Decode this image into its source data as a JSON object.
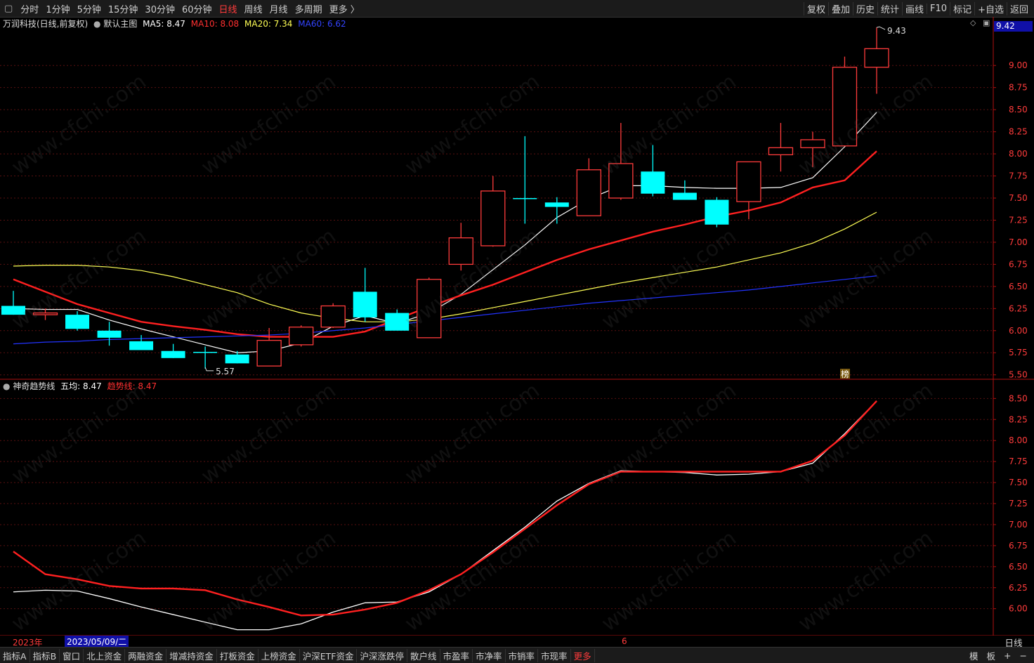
{
  "top_toolbar": {
    "periods": [
      "分时",
      "1分钟",
      "5分钟",
      "15分钟",
      "30分钟",
      "60分钟",
      "日线",
      "周线",
      "月线",
      "多周期",
      "更多 〉"
    ],
    "active_period": "日线",
    "tools": [
      "复权",
      "叠加",
      "历史",
      "统计",
      "画线",
      "F10",
      "标记",
      "+自选",
      "返回"
    ]
  },
  "main_legend": {
    "title": "万润科技(日线,前复权)",
    "template": "默认主图",
    "ma5_label": "MA5: 8.47",
    "ma10_label": "MA10: 8.08",
    "ma20_label": "MA20: 7.34",
    "ma60_label": "MA60: 6.62",
    "price_tag": "9.42"
  },
  "sub_legend": {
    "title": "神奇趋势线",
    "five_avg_label": "五均: 8.47",
    "trend_label": "趋势线: 8.47"
  },
  "colors": {
    "up": "#ff3b3b",
    "down": "#00ffff",
    "ma5": "#ffffff",
    "ma10": "#ff2020",
    "ma20": "#ffff55",
    "ma60": "#2233ff",
    "grid": "#5a1010"
  },
  "chart_data": [
    {
      "type": "candlestick",
      "title": "万润科技(日线,前复权)",
      "ylim": [
        5.45,
        9.55
      ],
      "y_ticks": [
        5.5,
        5.75,
        6.0,
        6.25,
        6.5,
        6.75,
        7.0,
        7.25,
        7.5,
        7.75,
        8.0,
        8.25,
        8.5,
        8.75,
        9.0
      ],
      "high_annotation": "9.43",
      "low_annotation": "5.57",
      "marker": "榜",
      "ohlc": [
        [
          6.28,
          6.45,
          6.18,
          6.18
        ],
        [
          6.18,
          6.25,
          6.12,
          6.2
        ],
        [
          6.18,
          6.22,
          6.0,
          6.02
        ],
        [
          6.0,
          6.1,
          5.83,
          5.92
        ],
        [
          5.88,
          5.95,
          5.79,
          5.78
        ],
        [
          5.77,
          5.85,
          5.69,
          5.69
        ],
        [
          5.76,
          5.82,
          5.57,
          5.76
        ],
        [
          5.73,
          5.77,
          5.63,
          5.63
        ],
        [
          5.6,
          6.03,
          5.6,
          5.89
        ],
        [
          5.84,
          6.06,
          5.82,
          6.04
        ],
        [
          6.04,
          6.31,
          6.03,
          6.28
        ],
        [
          6.44,
          6.71,
          6.1,
          6.15
        ],
        [
          6.2,
          6.24,
          6.01,
          6.0
        ],
        [
          5.92,
          6.6,
          5.92,
          6.58
        ],
        [
          6.75,
          7.22,
          6.68,
          7.05
        ],
        [
          6.96,
          7.75,
          6.95,
          7.58
        ],
        [
          7.5,
          8.2,
          7.21,
          7.5
        ],
        [
          7.45,
          7.51,
          7.21,
          7.4
        ],
        [
          7.3,
          7.95,
          7.3,
          7.82
        ],
        [
          7.5,
          8.35,
          7.48,
          7.89
        ],
        [
          7.8,
          8.1,
          7.52,
          7.55
        ],
        [
          7.56,
          7.7,
          7.48,
          7.48
        ],
        [
          7.48,
          7.51,
          7.17,
          7.2
        ],
        [
          7.46,
          7.91,
          7.26,
          7.91
        ],
        [
          7.99,
          8.35,
          7.8,
          8.07
        ],
        [
          8.07,
          8.25,
          7.85,
          8.16
        ],
        [
          8.09,
          9.1,
          8.09,
          8.98
        ],
        [
          8.98,
          9.43,
          8.68,
          9.19
        ]
      ],
      "series": [
        {
          "name": "MA5",
          "values": [
            6.25,
            6.24,
            6.24,
            6.12,
            6.02,
            5.93,
            5.84,
            5.75,
            5.77,
            5.86,
            6.05,
            6.17,
            6.08,
            6.2,
            6.41,
            6.69,
            6.97,
            7.28,
            7.49,
            7.64,
            7.64,
            7.62,
            7.61,
            7.61,
            7.62,
            7.73,
            8.08,
            8.47
          ]
        },
        {
          "name": "MA10",
          "values": [
            6.58,
            6.44,
            6.3,
            6.2,
            6.1,
            6.05,
            6.01,
            5.96,
            5.93,
            5.93,
            5.93,
            5.99,
            6.13,
            6.27,
            6.4,
            6.52,
            6.66,
            6.8,
            6.92,
            7.02,
            7.12,
            7.2,
            7.29,
            7.36,
            7.45,
            7.62,
            7.7,
            8.03
          ]
        },
        {
          "name": "MA20",
          "values": [
            6.73,
            6.74,
            6.74,
            6.72,
            6.68,
            6.61,
            6.52,
            6.43,
            6.3,
            6.2,
            6.14,
            6.1,
            6.1,
            6.13,
            6.19,
            6.26,
            6.33,
            6.4,
            6.47,
            6.54,
            6.6,
            6.66,
            6.72,
            6.8,
            6.88,
            6.99,
            7.15,
            7.34
          ]
        },
        {
          "name": "MA60",
          "values": [
            5.85,
            5.87,
            5.88,
            5.9,
            5.91,
            5.92,
            5.93,
            5.94,
            5.95,
            5.97,
            6.0,
            6.03,
            6.07,
            6.11,
            6.15,
            6.19,
            6.23,
            6.27,
            6.31,
            6.34,
            6.37,
            6.4,
            6.43,
            6.46,
            6.5,
            6.54,
            6.58,
            6.62
          ]
        }
      ]
    },
    {
      "type": "line",
      "title": "神奇趋势线",
      "ylim": [
        5.68,
        8.72
      ],
      "y_ticks": [
        6.0,
        6.25,
        6.5,
        6.75,
        7.0,
        7.25,
        7.5,
        7.75,
        8.0,
        8.25,
        8.5
      ],
      "series": [
        {
          "name": "五均",
          "values": [
            6.2,
            6.22,
            6.21,
            6.12,
            6.02,
            5.93,
            5.84,
            5.75,
            5.75,
            5.82,
            5.96,
            6.07,
            6.08,
            6.2,
            6.41,
            6.69,
            6.97,
            7.28,
            7.49,
            7.64,
            7.63,
            7.62,
            7.59,
            7.6,
            7.63,
            7.73,
            8.08,
            8.47
          ]
        },
        {
          "name": "趋势线",
          "values": [
            6.68,
            6.41,
            6.35,
            6.27,
            6.24,
            6.24,
            6.22,
            6.11,
            6.02,
            5.92,
            5.93,
            5.99,
            6.07,
            6.22,
            6.41,
            6.67,
            6.95,
            7.23,
            7.48,
            7.63,
            7.63,
            7.63,
            7.63,
            7.63,
            7.63,
            7.76,
            8.06,
            8.47
          ]
        }
      ]
    }
  ],
  "time_axis": {
    "year_label": "2023年",
    "cursor_date": "2023/05/09/二",
    "month_label": "6",
    "period_box": "日线"
  },
  "bottom_tabs": [
    "指标A",
    "指标B",
    "窗口",
    "北上资金",
    "两融资金",
    "增减持资金",
    "打板资金",
    "上榜资金",
    "沪深ETF资金",
    "沪深涨跌停",
    "散户线",
    "市盈率",
    "市净率",
    "市销率",
    "市现率",
    "更多"
  ],
  "bottom_right": [
    "模",
    "板",
    "+",
    "−"
  ]
}
